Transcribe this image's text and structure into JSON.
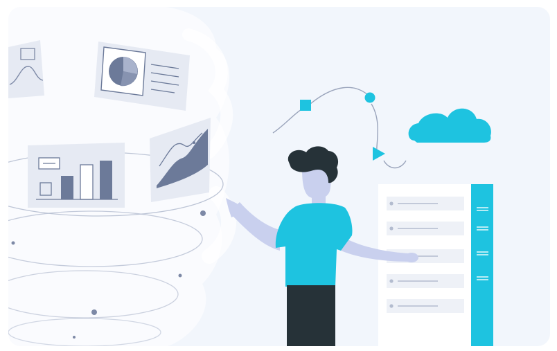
{
  "illustration": {
    "subject": "person-presenting-data",
    "colors": {
      "background": "#f2f6fc",
      "accent": "#1ec3e0",
      "slate": "#6c7a99",
      "skin": "#c9d0ee",
      "hair": "#263238",
      "pants": "#263238",
      "panel": "#ffffff",
      "line": "#c7cede"
    },
    "icons": [
      "line-chart-card-icon",
      "pie-chart-card-icon",
      "bar-chart-card-icon",
      "area-chart-card-icon",
      "cloud-icon",
      "square-node-icon",
      "circle-node-icon",
      "triangle-node-icon"
    ],
    "list_rows": 5,
    "sidebar_ticks": 4
  }
}
